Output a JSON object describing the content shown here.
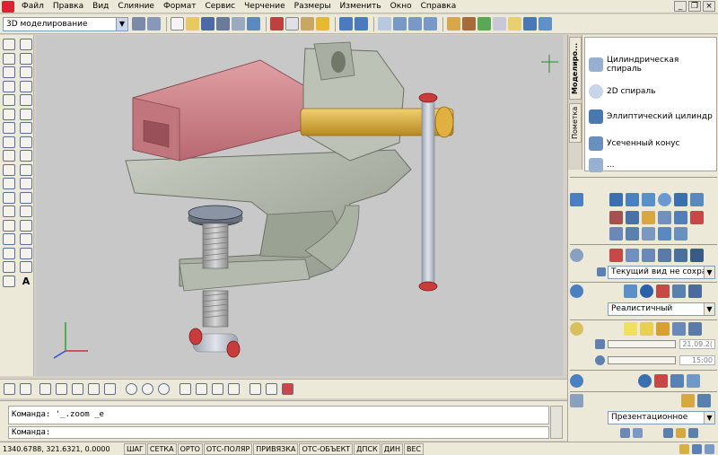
{
  "menu": {
    "items": [
      "Файл",
      "Правка",
      "Вид",
      "Слияние",
      "Формат",
      "Сервис",
      "Черчение",
      "Размеры",
      "Изменить",
      "Окно",
      "Справка"
    ],
    "min_label": "_",
    "restore_label": "❐",
    "close_label": "×"
  },
  "toolbar": {
    "workspace": "3D моделирование"
  },
  "left_tools": {
    "text_tool_label": "A"
  },
  "tool_palette": {
    "tab_modeling": "Моделиро...",
    "tab_annotation": "Пометка",
    "items": [
      "Цилиндрическая спираль",
      "2D спираль",
      "Эллиптический цилиндр",
      "Усеченный конус",
      "..."
    ]
  },
  "dashboard": {
    "view_select": "Текущий вид не сохран",
    "visual_style": "Реалистичный",
    "date_value": "21.09.2(",
    "time_value": "15:00",
    "render_preset": "Презентационное"
  },
  "command": {
    "history_line": "Команда: '_.zoom _e",
    "prompt": "Команда:"
  },
  "status": {
    "coords": "1340.6788, 321.6321, 0.0000",
    "buttons": [
      "ШАГ",
      "СЕТКА",
      "ОРТО",
      "ОТС-ПОЛЯР",
      "ПРИВЯЗКА",
      "ОТС-ОБЪЕКТ",
      "ДПСК",
      "ДИН",
      "ВЕС"
    ]
  },
  "colors": {
    "viewport_bg": "#c8c8c8",
    "jaw_pink": "#d4868a",
    "body_grey": "#a8b0a4",
    "brass": "#d8a838",
    "rod_grey": "#b8bcc4"
  }
}
